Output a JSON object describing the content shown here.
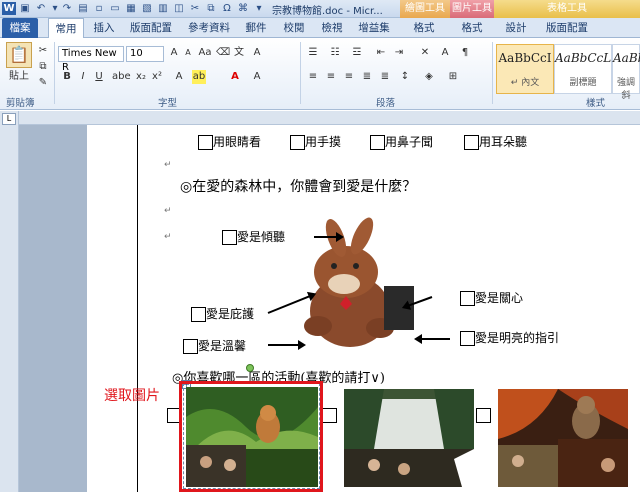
{
  "titlebar": {
    "document_title": "宗教博物館.doc - Micr...",
    "context_tab_picture_tools": "繪圖工具",
    "context_tab_image_tools": "圖片工具",
    "context_tab_table_tools": "表格工具"
  },
  "tabs": [
    {
      "label": "檔案"
    },
    {
      "label": "常用"
    },
    {
      "label": "插入"
    },
    {
      "label": "版面配置"
    },
    {
      "label": "參考資料"
    },
    {
      "label": "郵件"
    },
    {
      "label": "校閱"
    },
    {
      "label": "檢視"
    },
    {
      "label": "增益集"
    },
    {
      "label": "格式"
    },
    {
      "label": "格式"
    },
    {
      "label": "設計"
    },
    {
      "label": "版面配置"
    }
  ],
  "ribbon": {
    "paste_label": "貼上",
    "clipboard_group": "剪貼簿",
    "font_group": "字型",
    "paragraph_group": "段落",
    "styles_group": "樣式",
    "font_name": "Times New R",
    "font_size": "10",
    "styles": [
      {
        "sample": "AaBbCcI",
        "name": "↵ 內文"
      },
      {
        "sample": "AaBbCcL",
        "name": "副標題"
      },
      {
        "sample": "AaBbCcI",
        "name": "強調斜"
      }
    ]
  },
  "document": {
    "option_eyes": "用眼睛看",
    "option_hand": "用手摸",
    "option_nose": "用鼻子聞",
    "option_ear": "用耳朵聽",
    "question_forest": "◎在愛的森林中，你體會到愛是什麼？",
    "love_listen": "愛是傾聽",
    "love_care": "愛是關心",
    "love_protect": "愛是庇護",
    "love_warm": "愛是溫馨",
    "love_guide": "愛是明亮的指引",
    "question_activity": "◎你喜歡哪一區的活動(喜歡的請打∨)",
    "select_picture_label": "選取圖片",
    "para_mark": "↵"
  },
  "colors": {
    "select_label": "#e0161c",
    "selection_box": "#e0161c",
    "file_tab": "#2b5fa8"
  }
}
